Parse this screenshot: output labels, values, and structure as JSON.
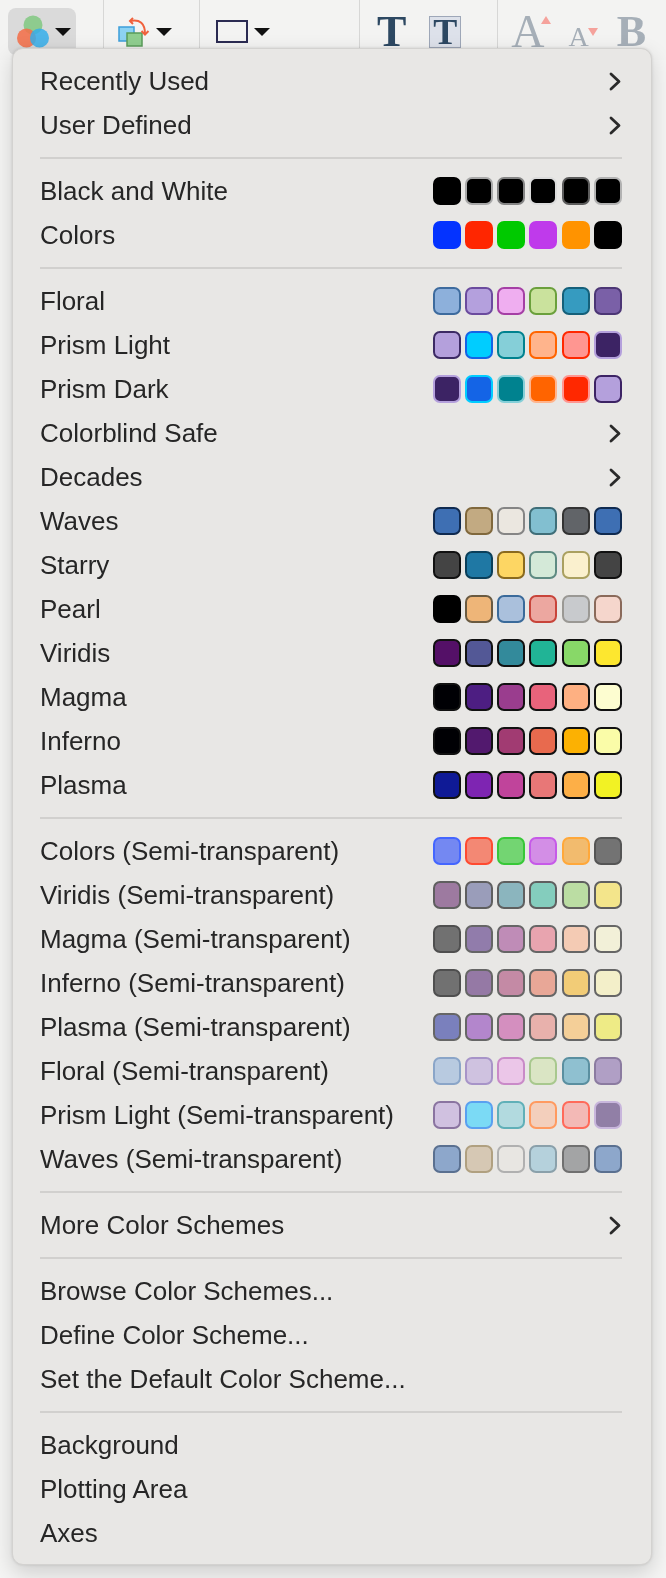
{
  "toolbar": {
    "groups": [
      {
        "items": [
          {
            "kind": "scheme",
            "pressed": true,
            "disabled": false
          }
        ]
      },
      {
        "items": [
          {
            "kind": "arrange",
            "pressed": false,
            "disabled": false
          }
        ]
      },
      {
        "items": [
          {
            "kind": "shape",
            "pressed": false,
            "disabled": false
          }
        ]
      },
      {
        "items": [
          {
            "kind": "text",
            "label": "T",
            "pressed": false,
            "disabled": false
          },
          {
            "kind": "boxed",
            "label": "T",
            "pressed": false,
            "disabled": false
          }
        ]
      },
      {
        "items": [
          {
            "kind": "grow",
            "label": "A",
            "pressed": false,
            "disabled": true
          },
          {
            "kind": "shrink",
            "label": "A",
            "pressed": false,
            "disabled": true
          },
          {
            "kind": "bold",
            "label": "B",
            "pressed": false,
            "disabled": true
          }
        ]
      }
    ]
  },
  "menu": {
    "sections": [
      {
        "items": [
          {
            "kind": "submenu",
            "label": "Recently Used"
          },
          {
            "kind": "submenu",
            "label": "User Defined"
          }
        ]
      },
      {
        "items": [
          {
            "kind": "scheme",
            "label": "Black and White",
            "swatches": [
              {
                "color": "#000000",
                "outline": {
                  "color": "#000000"
                }
              },
              {
                "color": "#000000",
                "outline": {
                  "color": "#a8a8a8"
                }
              },
              {
                "color": "#000000",
                "outline": {
                  "color": "#858585"
                }
              },
              {
                "color": "#000000",
                "outline": {
                  "color": "#dcdcdc"
                }
              },
              {
                "color": "#000000",
                "outline": {
                  "color": "#5c5c5c"
                }
              },
              {
                "color": "#000000",
                "outline": {
                  "color": "#b2b2b2"
                }
              }
            ]
          },
          {
            "kind": "scheme",
            "label": "Colors",
            "swatches": [
              {
                "color": "#0433ff",
                "outline": {
                  "color": "#0433ff"
                }
              },
              {
                "color": "#ff2600",
                "outline": {
                  "color": "#ff2600"
                }
              },
              {
                "color": "#00c900",
                "outline": {
                  "color": "#00c900"
                }
              },
              {
                "color": "#bf3aeb",
                "outline": {
                  "color": "#bf3aeb"
                }
              },
              {
                "color": "#ff9300",
                "outline": {
                  "color": "#ff9300"
                }
              },
              {
                "color": "#000000",
                "outline": {
                  "color": "#000000"
                }
              }
            ]
          }
        ]
      },
      {
        "items": [
          {
            "kind": "scheme",
            "label": "Floral",
            "swatches": [
              {
                "color": "#8db0db",
                "outline": {
                  "color": "#3d6b9e"
                }
              },
              {
                "color": "#b4a0dd",
                "outline": {
                  "color": "#6b4b9e"
                }
              },
              {
                "color": "#efaef0",
                "outline": {
                  "color": "#a53fa5"
                }
              },
              {
                "color": "#cae29d",
                "outline": {
                  "color": "#6ba03c"
                }
              },
              {
                "color": "#369bc0",
                "outline": {
                  "color": "#15607a"
                }
              },
              {
                "color": "#7a60a7",
                "outline": {
                  "color": "#4c3675"
                }
              }
            ]
          },
          {
            "kind": "scheme",
            "label": "Prism Light",
            "swatches": [
              {
                "color": "#b4a0dc",
                "outline": {
                  "color": "#3c2a64"
                }
              },
              {
                "color": "#00cdff",
                "outline": {
                  "color": "#1464e6"
                }
              },
              {
                "color": "#85cfd8",
                "outline": {
                  "color": "#00828f"
                }
              },
              {
                "color": "#ffb48c",
                "outline": {
                  "color": "#ff6400"
                }
              },
              {
                "color": "#ff9691",
                "outline": {
                  "color": "#ff2800"
                }
              },
              {
                "color": "#3c2364",
                "outline": {
                  "color": "#b4a0dc"
                }
              }
            ]
          },
          {
            "kind": "scheme",
            "label": "Prism Dark",
            "swatches": [
              {
                "color": "#3c2364",
                "outline": {
                  "color": "#b4a0dc"
                }
              },
              {
                "color": "#1464e6",
                "outline": {
                  "color": "#00cdff"
                }
              },
              {
                "color": "#00828f",
                "outline": {
                  "color": "#85cfd8"
                }
              },
              {
                "color": "#ff6400",
                "outline": {
                  "color": "#ffb48c"
                }
              },
              {
                "color": "#ff2800",
                "outline": {
                  "color": "#ff9691"
                }
              },
              {
                "color": "#b4a0dc",
                "outline": {
                  "color": "#3c2364"
                }
              }
            ]
          },
          {
            "kind": "submenu",
            "label": "Colorblind Safe"
          },
          {
            "kind": "submenu",
            "label": "Decades"
          },
          {
            "kind": "scheme",
            "label": "Waves",
            "swatches": [
              {
                "color": "#3e6fb3",
                "outline": {
                  "color": "#0f2a50"
                }
              },
              {
                "color": "#c2aa82",
                "outline": {
                  "color": "#80683c"
                }
              },
              {
                "color": "#ebe7e0",
                "outline": {
                  "color": "#858585"
                }
              },
              {
                "color": "#82bfd0",
                "outline": {
                  "color": "#3f6e78"
                }
              },
              {
                "color": "#616468",
                "outline": {
                  "color": "#333333"
                }
              },
              {
                "color": "#3e6fb3",
                "outline": {
                  "color": "#0f2a50"
                }
              }
            ]
          },
          {
            "kind": "scheme",
            "label": "Starry",
            "swatches": [
              {
                "color": "#444444",
                "outline": {
                  "color": "#111111"
                }
              },
              {
                "color": "#1f78a4",
                "outline": {
                  "color": "#0a3f5a"
                }
              },
              {
                "color": "#fdd663",
                "outline": {
                  "color": "#8a6a1e"
                }
              },
              {
                "color": "#d4e9d8",
                "outline": {
                  "color": "#5e8a82"
                }
              },
              {
                "color": "#faf0ce",
                "outline": {
                  "color": "#aaa060"
                }
              },
              {
                "color": "#444444",
                "outline": {
                  "color": "#111111"
                }
              }
            ]
          },
          {
            "kind": "scheme",
            "label": "Pearl",
            "swatches": [
              {
                "color": "#000000",
                "outline": {
                  "color": "#000000"
                }
              },
              {
                "color": "#eeb578",
                "outline": {
                  "color": "#6a5a40"
                }
              },
              {
                "color": "#aac0dc",
                "outline": {
                  "color": "#3a6a9a"
                }
              },
              {
                "color": "#eca7a0",
                "outline": {
                  "color": "#c8443a"
                }
              },
              {
                "color": "#c8cacd",
                "outline": {
                  "color": "#9a9894"
                }
              },
              {
                "color": "#f5d6cc",
                "outline": {
                  "color": "#8a6a5a"
                }
              }
            ]
          },
          {
            "kind": "scheme",
            "label": "Viridis",
            "swatches": [
              {
                "color": "#541067",
                "outline": {
                  "color": "#111111"
                }
              },
              {
                "color": "#535896",
                "outline": {
                  "color": "#111111"
                }
              },
              {
                "color": "#338a9b",
                "outline": {
                  "color": "#111111"
                }
              },
              {
                "color": "#21b496",
                "outline": {
                  "color": "#111111"
                }
              },
              {
                "color": "#88d868",
                "outline": {
                  "color": "#111111"
                }
              },
              {
                "color": "#fde72f",
                "outline": {
                  "color": "#111111"
                }
              }
            ]
          },
          {
            "kind": "scheme",
            "label": "Magma",
            "swatches": [
              {
                "color": "#000004",
                "outline": {
                  "color": "#111111"
                }
              },
              {
                "color": "#4d1e82",
                "outline": {
                  "color": "#111111"
                }
              },
              {
                "color": "#9a3d8e",
                "outline": {
                  "color": "#111111"
                }
              },
              {
                "color": "#e8637b",
                "outline": {
                  "color": "#111111"
                }
              },
              {
                "color": "#feb082",
                "outline": {
                  "color": "#111111"
                }
              },
              {
                "color": "#fdfdd0",
                "outline": {
                  "color": "#111111"
                }
              }
            ]
          },
          {
            "kind": "scheme",
            "label": "Inferno",
            "swatches": [
              {
                "color": "#000004",
                "outline": {
                  "color": "#111111"
                }
              },
              {
                "color": "#52196e",
                "outline": {
                  "color": "#111111"
                }
              },
              {
                "color": "#a13b72",
                "outline": {
                  "color": "#111111"
                }
              },
              {
                "color": "#e86a4e",
                "outline": {
                  "color": "#111111"
                }
              },
              {
                "color": "#fcb102",
                "outline": {
                  "color": "#111111"
                }
              },
              {
                "color": "#fafca8",
                "outline": {
                  "color": "#111111"
                }
              }
            ]
          },
          {
            "kind": "scheme",
            "label": "Plasma",
            "swatches": [
              {
                "color": "#0f1a96",
                "outline": {
                  "color": "#111111"
                }
              },
              {
                "color": "#7e25b2",
                "outline": {
                  "color": "#111111"
                }
              },
              {
                "color": "#c0449b",
                "outline": {
                  "color": "#111111"
                }
              },
              {
                "color": "#e87777",
                "outline": {
                  "color": "#111111"
                }
              },
              {
                "color": "#fdaf47",
                "outline": {
                  "color": "#111111"
                }
              },
              {
                "color": "#f2f224",
                "outline": {
                  "color": "#111111"
                }
              }
            ]
          }
        ]
      },
      {
        "items": [
          {
            "kind": "scheme",
            "label": "Colors (Semi-transparent)",
            "swatches": [
              {
                "color": "#7488f2",
                "outline": {
                  "color": "#4466ff"
                }
              },
              {
                "color": "#f38874",
                "outline": {
                  "color": "#ff4a30"
                }
              },
              {
                "color": "#73d572",
                "outline": {
                  "color": "#38c838"
                }
              },
              {
                "color": "#d38ee6",
                "outline": {
                  "color": "#c65ae8"
                }
              },
              {
                "color": "#f2bb6e",
                "outline": {
                  "color": "#ffa83a"
                }
              },
              {
                "color": "#737373",
                "outline": {
                  "color": "#555555"
                }
              }
            ]
          },
          {
            "kind": "scheme",
            "label": "Viridis (Semi-transparent)",
            "swatches": [
              {
                "color": "#9d7aa0",
                "outline": {
                  "color": "#5f5f5f"
                }
              },
              {
                "color": "#9a9dba",
                "outline": {
                  "color": "#5f5f5f"
                }
              },
              {
                "color": "#8bb5be",
                "outline": {
                  "color": "#5f5f5f"
                }
              },
              {
                "color": "#84cdbd",
                "outline": {
                  "color": "#5f5f5f"
                }
              },
              {
                "color": "#bbdda3",
                "outline": {
                  "color": "#5f5f5f"
                }
              },
              {
                "color": "#f3e58b",
                "outline": {
                  "color": "#5f5f5f"
                }
              }
            ]
          },
          {
            "kind": "scheme",
            "label": "Magma (Semi-transparent)",
            "swatches": [
              {
                "color": "#717171",
                "outline": {
                  "color": "#4f4f4f"
                }
              },
              {
                "color": "#917cab",
                "outline": {
                  "color": "#666666"
                }
              },
              {
                "color": "#bf8cb7",
                "outline": {
                  "color": "#666666"
                }
              },
              {
                "color": "#e8a4af",
                "outline": {
                  "color": "#666666"
                }
              },
              {
                "color": "#f4cbb4",
                "outline": {
                  "color": "#666666"
                }
              },
              {
                "color": "#f2f0d8",
                "outline": {
                  "color": "#666666"
                }
              }
            ]
          },
          {
            "kind": "scheme",
            "label": "Inferno (Semi-transparent)",
            "swatches": [
              {
                "color": "#717171",
                "outline": {
                  "color": "#4f4f4f"
                }
              },
              {
                "color": "#9579a5",
                "outline": {
                  "color": "#666666"
                }
              },
              {
                "color": "#c48aa5",
                "outline": {
                  "color": "#666666"
                }
              },
              {
                "color": "#e8a797",
                "outline": {
                  "color": "#666666"
                }
              },
              {
                "color": "#f2cc77",
                "outline": {
                  "color": "#666666"
                }
              },
              {
                "color": "#f3efc9",
                "outline": {
                  "color": "#666666"
                }
              }
            ]
          },
          {
            "kind": "scheme",
            "label": "Plasma (Semi-transparent)",
            "swatches": [
              {
                "color": "#7a80bd",
                "outline": {
                  "color": "#666666"
                }
              },
              {
                "color": "#b386cc",
                "outline": {
                  "color": "#666666"
                }
              },
              {
                "color": "#d48fbf",
                "outline": {
                  "color": "#666666"
                }
              },
              {
                "color": "#e8b1ac",
                "outline": {
                  "color": "#666666"
                }
              },
              {
                "color": "#f4cf98",
                "outline": {
                  "color": "#666666"
                }
              },
              {
                "color": "#eeeb86",
                "outline": {
                  "color": "#666666"
                }
              }
            ]
          },
          {
            "kind": "scheme",
            "label": "Floral (Semi-transparent)",
            "swatches": [
              {
                "color": "#b8cae0",
                "outline": {
                  "color": "#8aa5c8"
                }
              },
              {
                "color": "#cfc2e0",
                "outline": {
                  "color": "#a794c8"
                }
              },
              {
                "color": "#ebc6e8",
                "outline": {
                  "color": "#c98ac8"
                }
              },
              {
                "color": "#dae5c4",
                "outline": {
                  "color": "#a8c88e"
                }
              },
              {
                "color": "#8fc0d0",
                "outline": {
                  "color": "#5a8fa0"
                }
              },
              {
                "color": "#b09fc5",
                "outline": {
                  "color": "#8b7ba0"
                }
              }
            ]
          },
          {
            "kind": "scheme",
            "label": "Prism Light (Semi-transparent)",
            "swatches": [
              {
                "color": "#d0c1e0",
                "outline": {
                  "color": "#8a74a0"
                }
              },
              {
                "color": "#7bdaf5",
                "outline": {
                  "color": "#5aa0f0"
                }
              },
              {
                "color": "#b2dadf",
                "outline": {
                  "color": "#60b0b8"
                }
              },
              {
                "color": "#f3cfbc",
                "outline": {
                  "color": "#ff9a60"
                }
              },
              {
                "color": "#f3b9b6",
                "outline": {
                  "color": "#ff6a5a"
                }
              },
              {
                "color": "#917fa6",
                "outline": {
                  "color": "#c8b6dc"
                }
              }
            ]
          },
          {
            "kind": "scheme",
            "label": "Waves (Semi-transparent)",
            "swatches": [
              {
                "color": "#8da7cb",
                "outline": {
                  "color": "#5a7090"
                }
              },
              {
                "color": "#d6c8b4",
                "outline": {
                  "color": "#b0a080"
                }
              },
              {
                "color": "#e8e6e2",
                "outline": {
                  "color": "#b0b0b0"
                }
              },
              {
                "color": "#b5d1dc",
                "outline": {
                  "color": "#8aa0aa"
                }
              },
              {
                "color": "#a3a4a5",
                "outline": {
                  "color": "#707070"
                }
              },
              {
                "color": "#8da7cb",
                "outline": {
                  "color": "#5a7090"
                }
              }
            ]
          }
        ]
      },
      {
        "items": [
          {
            "kind": "submenu",
            "label": "More Color Schemes"
          }
        ]
      },
      {
        "items": [
          {
            "kind": "action",
            "label": "Browse Color Schemes..."
          },
          {
            "kind": "action",
            "label": "Define Color Scheme..."
          },
          {
            "kind": "action",
            "label": "Set the Default Color Scheme..."
          }
        ]
      },
      {
        "items": [
          {
            "kind": "action",
            "label": "Background"
          },
          {
            "kind": "action",
            "label": "Plotting Area"
          },
          {
            "kind": "action",
            "label": "Axes"
          }
        ]
      }
    ]
  }
}
